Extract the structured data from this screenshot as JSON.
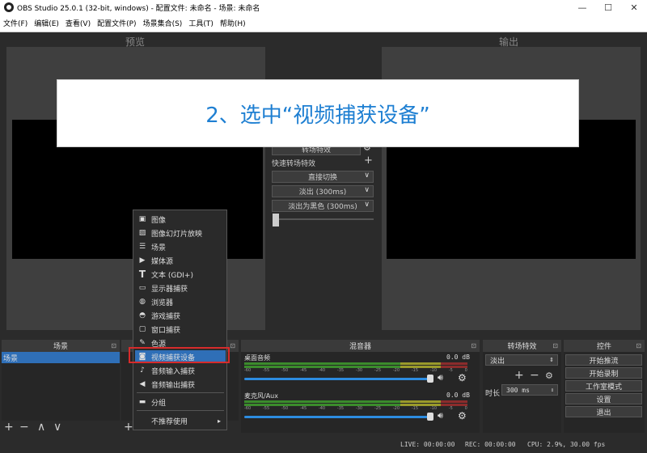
{
  "window": {
    "title": "OBS Studio 25.0.1 (32-bit, windows) - 配置文件: 未命名 - 场景: 未命名",
    "minimize": "—",
    "maximize": "☐",
    "close": "✕"
  },
  "menu": [
    "文件(F)",
    "编辑(E)",
    "查看(V)",
    "配置文件(P)",
    "场景集合(S)",
    "工具(T)",
    "帮助(H)"
  ],
  "preview": {
    "title": "预览"
  },
  "output": {
    "title": "输出"
  },
  "banner": {
    "text": "2、选中“视频捕获设备”"
  },
  "transitions_mid": {
    "partial_label": "转场特效",
    "quick_label": "快速转场特效",
    "items": [
      "直接切换",
      "淡出 (300ms)",
      "淡出为黑色 (300ms)"
    ]
  },
  "context_menu": {
    "items": [
      {
        "label": "图像",
        "icon": "image-icon"
      },
      {
        "label": "图像幻灯片放映",
        "icon": "slideshow-icon"
      },
      {
        "label": "场景",
        "icon": "list-icon"
      },
      {
        "label": "媒体源",
        "icon": "play-icon"
      },
      {
        "label": "文本 (GDI+)",
        "icon": "text-icon"
      },
      {
        "label": "显示器捕获",
        "icon": "monitor-icon"
      },
      {
        "label": "浏览器",
        "icon": "globe-icon"
      },
      {
        "label": "游戏捕获",
        "icon": "gamepad-icon"
      },
      {
        "label": "窗口捕获",
        "icon": "window-icon"
      },
      {
        "label": "色源",
        "icon": "brush-icon"
      },
      {
        "label": "视频捕获设备",
        "icon": "camera-icon",
        "selected": true
      },
      {
        "label": "音频输入捕获",
        "icon": "mic-icon"
      },
      {
        "label": "音频输出捕获",
        "icon": "speaker-icon"
      }
    ],
    "group": {
      "label": "分组",
      "icon": "folder-icon"
    },
    "deprecated": {
      "label": "不推荐使用",
      "icon": "chevron-right-icon"
    }
  },
  "docks": {
    "scenes": {
      "title": "场景",
      "items": [
        "场景"
      ]
    },
    "mixer": {
      "title": "混音器",
      "channels": [
        {
          "name": "桌面音频",
          "db": "0.0 dB",
          "volume": 1.0
        },
        {
          "name": "麦克风/Aux",
          "db": "0.0 dB",
          "volume": 1.0
        }
      ],
      "scale": [
        "-60",
        "-55",
        "-50",
        "-45",
        "-40",
        "-35",
        "-30",
        "-25",
        "-20",
        "-15",
        "-10",
        "-5",
        "0"
      ]
    },
    "transitions": {
      "title": "转场特效",
      "selected": "淡出",
      "duration_label": "时长",
      "duration_value": "300 ms"
    },
    "controls": {
      "title": "控件",
      "buttons": [
        "开始推流",
        "开始录制",
        "工作室模式",
        "设置",
        "退出"
      ]
    }
  },
  "status": {
    "live": "LIVE: 00:00:00",
    "rec": "REC: 00:00:00",
    "cpu": "CPU: 2.9%, 30.00 fps"
  },
  "colors": {
    "accent": "#1e7fd2",
    "selection": "#2f6fb7",
    "highlight_border": "#d62b2b"
  }
}
